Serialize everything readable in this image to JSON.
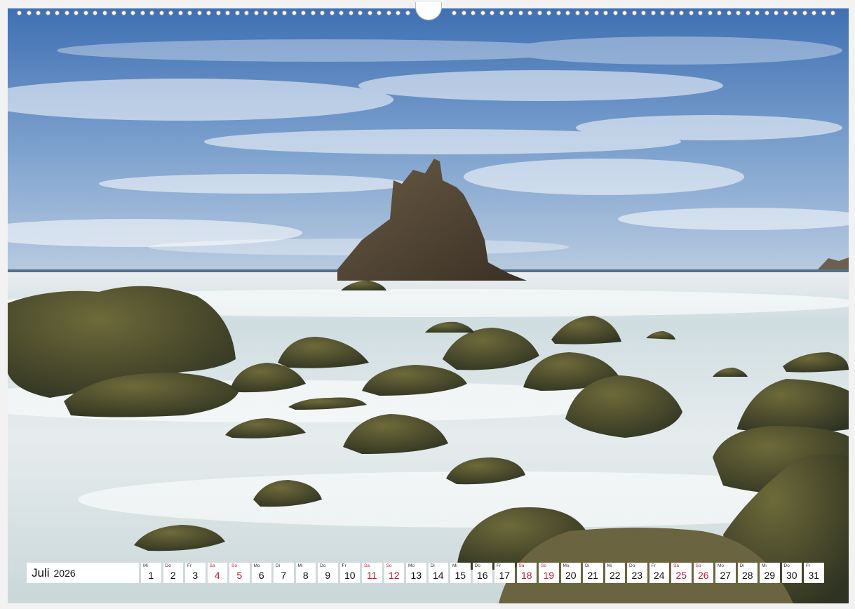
{
  "calendar": {
    "month": "Juli",
    "year": "2026",
    "weekend_color": "#c6182b",
    "days": [
      {
        "wd": "Mi",
        "n": "1",
        "we": false
      },
      {
        "wd": "Do",
        "n": "2",
        "we": false
      },
      {
        "wd": "Fr",
        "n": "3",
        "we": false
      },
      {
        "wd": "Sa",
        "n": "4",
        "we": true
      },
      {
        "wd": "So",
        "n": "5",
        "we": true
      },
      {
        "wd": "Mo",
        "n": "6",
        "we": false
      },
      {
        "wd": "Di",
        "n": "7",
        "we": false
      },
      {
        "wd": "Mi",
        "n": "8",
        "we": false
      },
      {
        "wd": "Do",
        "n": "9",
        "we": false
      },
      {
        "wd": "Fr",
        "n": "10",
        "we": false
      },
      {
        "wd": "Sa",
        "n": "11",
        "we": true
      },
      {
        "wd": "So",
        "n": "12",
        "we": true
      },
      {
        "wd": "Mo",
        "n": "13",
        "we": false
      },
      {
        "wd": "Di",
        "n": "14",
        "we": false
      },
      {
        "wd": "Mi",
        "n": "15",
        "we": false
      },
      {
        "wd": "Do",
        "n": "16",
        "we": false
      },
      {
        "wd": "Fr",
        "n": "17",
        "we": false
      },
      {
        "wd": "Sa",
        "n": "18",
        "we": true
      },
      {
        "wd": "So",
        "n": "19",
        "we": true
      },
      {
        "wd": "Mo",
        "n": "20",
        "we": false
      },
      {
        "wd": "Di",
        "n": "21",
        "we": false
      },
      {
        "wd": "Mi",
        "n": "22",
        "we": false
      },
      {
        "wd": "Do",
        "n": "23",
        "we": false
      },
      {
        "wd": "Fr",
        "n": "24",
        "we": false
      },
      {
        "wd": "Sa",
        "n": "25",
        "we": true
      },
      {
        "wd": "So",
        "n": "26",
        "we": true
      },
      {
        "wd": "Mo",
        "n": "27",
        "we": false
      },
      {
        "wd": "Di",
        "n": "28",
        "we": false
      },
      {
        "wd": "Mi",
        "n": "29",
        "we": false
      },
      {
        "wd": "Do",
        "n": "30",
        "we": false
      },
      {
        "wd": "Fr",
        "n": "31",
        "we": false
      }
    ]
  },
  "photo": {
    "subject": "sea-stack-with-misty-sea-and-boulders",
    "sky_color": "#4f7fbd",
    "sea_mist_color": "#dfe7ea",
    "rock_color": "#4a4a2e"
  }
}
